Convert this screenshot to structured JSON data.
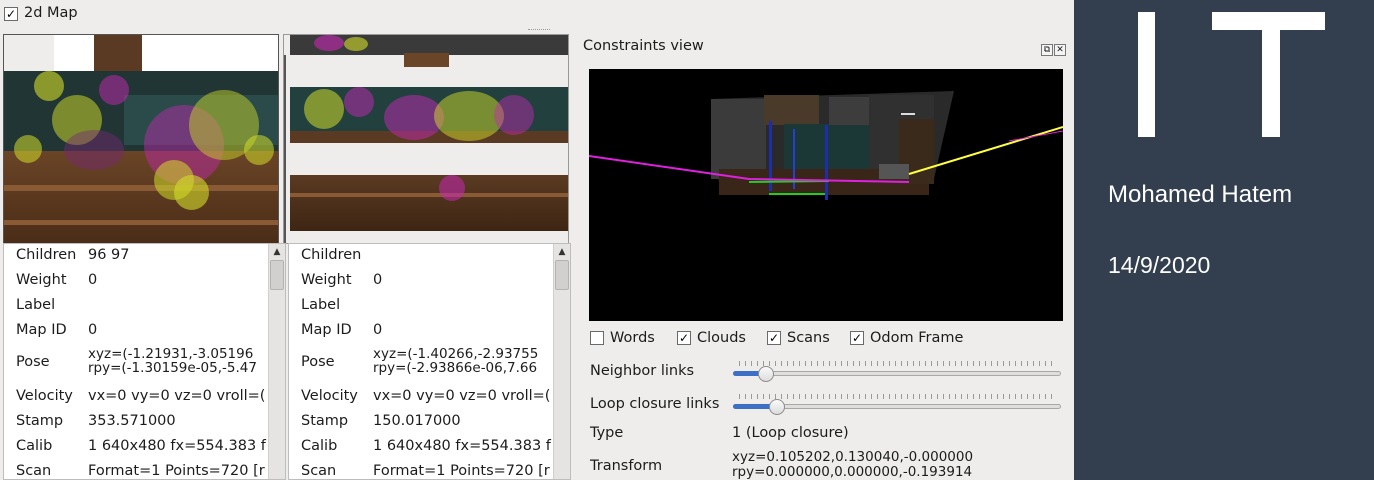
{
  "map2d": {
    "checked": true,
    "title": "2d Map"
  },
  "panel_left": {
    "rows": [
      {
        "key": "Children",
        "value": "96 97"
      },
      {
        "key": "Weight",
        "value": "0"
      },
      {
        "key": "Label",
        "value": ""
      },
      {
        "key": "Map ID",
        "value": "0"
      },
      {
        "key": "Pose",
        "value_line1": "xyz=(-1.21931,-3.05196",
        "value_line2": "rpy=(-1.30159e-05,-5.47"
      },
      {
        "key": "Velocity",
        "value": "vx=0 vy=0 vz=0 vroll=("
      },
      {
        "key": "Stamp",
        "value": "353.571000"
      },
      {
        "key": "Calib",
        "value": "1 640x480 fx=554.383 f"
      },
      {
        "key": "Scan",
        "value": "Format=1 Points=720 [r"
      }
    ]
  },
  "panel_right": {
    "rows": [
      {
        "key": "Children",
        "value": ""
      },
      {
        "key": "Weight",
        "value": "0"
      },
      {
        "key": "Label",
        "value": ""
      },
      {
        "key": "Map ID",
        "value": "0"
      },
      {
        "key": "Pose",
        "value_line1": "xyz=(-1.40266,-2.93755",
        "value_line2": "rpy=(-2.93866e-06,7.66"
      },
      {
        "key": "Velocity",
        "value": "vx=0 vy=0 vz=0 vroll=("
      },
      {
        "key": "Stamp",
        "value": "150.017000"
      },
      {
        "key": "Calib",
        "value": "1 640x480 fx=554.383 f"
      },
      {
        "key": "Scan",
        "value": "Format=1 Points=720 [r"
      }
    ]
  },
  "constraints": {
    "title": "Constraints view",
    "options": [
      {
        "label": "Words",
        "checked": false
      },
      {
        "label": "Clouds",
        "checked": true
      },
      {
        "label": "Scans",
        "checked": true
      },
      {
        "label": "Odom Frame",
        "checked": true
      }
    ],
    "neighbor_links": {
      "label": "Neighbor links",
      "position": 0.08
    },
    "loop_closure_links": {
      "label": "Loop closure links",
      "position": 0.115
    },
    "type": {
      "label": "Type",
      "value": "1  (Loop closure)"
    },
    "transform": {
      "label": "Transform",
      "value_line1": "xyz=0.105202,0.130040,-0.000000",
      "value_line2": "rpy=0.000000,0.000000,-0.193914"
    }
  },
  "side": {
    "logo": "IT",
    "name": "Mohamed Hatem",
    "date": "14/9/2020"
  },
  "colors": {
    "window_bg": "#efedeb",
    "side_bg": "#333f4f",
    "canvas_bg": "#000000",
    "scan_magenta": "#e020e0",
    "scan_yellow": "#ffff40"
  }
}
